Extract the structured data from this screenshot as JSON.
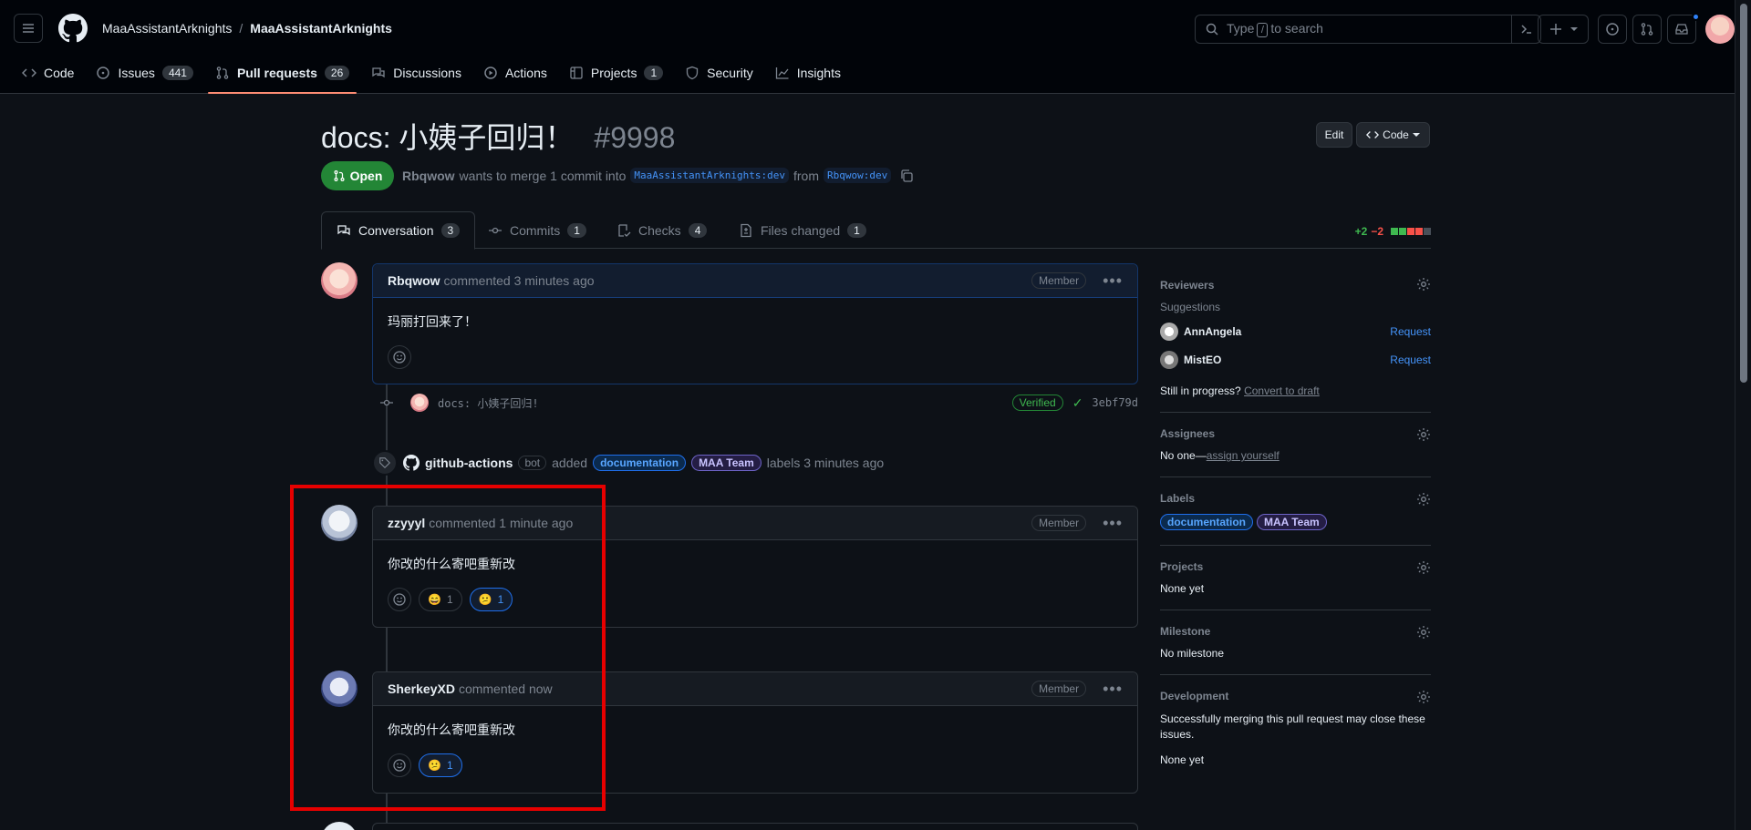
{
  "header": {
    "owner": "MaaAssistantArknights",
    "repo": "MaaAssistantArknights",
    "search_pre": "Type",
    "search_key": "/",
    "search_post": "to search"
  },
  "repo_nav": [
    {
      "label": "Code",
      "count": null,
      "icon": "code-icon"
    },
    {
      "label": "Issues",
      "count": "441",
      "icon": "issue-icon"
    },
    {
      "label": "Pull requests",
      "count": "26",
      "icon": "pull-request-icon"
    },
    {
      "label": "Discussions",
      "count": null,
      "icon": "discussion-icon"
    },
    {
      "label": "Actions",
      "count": null,
      "icon": "play-icon"
    },
    {
      "label": "Projects",
      "count": "1",
      "icon": "table-icon"
    },
    {
      "label": "Security",
      "count": null,
      "icon": "shield-icon"
    },
    {
      "label": "Insights",
      "count": null,
      "icon": "graph-icon"
    }
  ],
  "pr": {
    "title": "docs: 小姨子回归！",
    "number": "#9998",
    "state": "Open",
    "author": "Rbqwow",
    "meta_mid": "wants to merge 1 commit into",
    "base": "MaaAssistantArknights:dev",
    "from": "from",
    "head": "Rbqwow:dev",
    "edit_label": "Edit",
    "code_label": "Code"
  },
  "pr_tabs": [
    {
      "label": "Conversation",
      "count": "3"
    },
    {
      "label": "Commits",
      "count": "1"
    },
    {
      "label": "Checks",
      "count": "4"
    },
    {
      "label": "Files changed",
      "count": "1"
    }
  ],
  "diffstat": {
    "add": "+2",
    "del": "−2"
  },
  "comments": [
    {
      "author": "Rbqwow",
      "when": "commented 3 minutes ago",
      "role": "Member",
      "body": "玛丽打回来了！"
    },
    {
      "author": "zzyyyl",
      "when": "commented 1 minute ago",
      "role": "Member",
      "body": "你改的什么寄吧重新改",
      "reactions": [
        {
          "emoji": "😄",
          "count": "1"
        },
        {
          "emoji": "😕",
          "count": "1"
        }
      ]
    },
    {
      "author": "SherkeyXD",
      "when": "commented now",
      "role": "Member",
      "body": "你改的什么寄吧重新改",
      "reactions": [
        {
          "emoji": "😕",
          "count": "1"
        }
      ]
    }
  ],
  "commit": {
    "message": "docs: 小姨子回归!",
    "verified": "Verified",
    "sha": "3ebf79d"
  },
  "event": {
    "actor": "github-actions",
    "bot": "bot",
    "action": "added",
    "labels": [
      "documentation",
      "MAA Team"
    ],
    "suffix": "labels 3 minutes ago"
  },
  "sidebar": {
    "reviewers_title": "Reviewers",
    "suggestions": "Suggestions",
    "reviewers": [
      {
        "name": "AnnAngela",
        "action": "Request"
      },
      {
        "name": "MistEO",
        "action": "Request"
      }
    ],
    "progress_text": "Still in progress?",
    "convert_draft": "Convert to draft",
    "assignees_title": "Assignees",
    "assignees_none": "No one—",
    "assign_yourself": "assign yourself",
    "labels_title": "Labels",
    "labels": [
      "documentation",
      "MAA Team"
    ],
    "projects_title": "Projects",
    "projects_value": "None yet",
    "milestone_title": "Milestone",
    "milestone_value": "No milestone",
    "development_title": "Development",
    "development_text": "Successfully merging this pull request may close these issues.",
    "development_value": "None yet"
  },
  "colors": {
    "accent": "#2f81f7",
    "open": "#238636",
    "highlight": "#e60000"
  }
}
